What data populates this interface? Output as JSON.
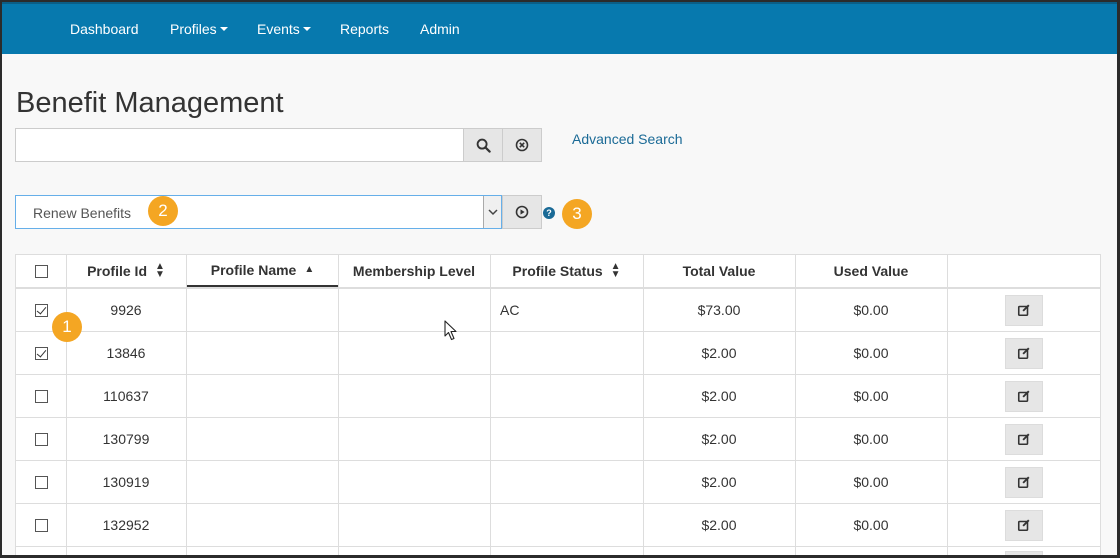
{
  "nav": {
    "items": [
      {
        "label": "Dashboard",
        "dropdown": false
      },
      {
        "label": "Profiles",
        "dropdown": true
      },
      {
        "label": "Events",
        "dropdown": true
      },
      {
        "label": "Reports",
        "dropdown": false
      },
      {
        "label": "Admin",
        "dropdown": false
      }
    ]
  },
  "page": {
    "title": "Benefit Management"
  },
  "search": {
    "value": "",
    "placeholder": "",
    "advanced_label": "Advanced Search"
  },
  "action": {
    "selected": "Renew Benefits"
  },
  "badges": [
    "1",
    "2",
    "3"
  ],
  "table": {
    "columns": [
      {
        "label": "",
        "sort": "none"
      },
      {
        "label": "Profile Id",
        "sort": "both"
      },
      {
        "label": "Profile Name",
        "sort": "asc"
      },
      {
        "label": "Membership Level",
        "sort": "none"
      },
      {
        "label": "Profile Status",
        "sort": "both"
      },
      {
        "label": "Total Value",
        "sort": "none"
      },
      {
        "label": "Used Value",
        "sort": "none"
      },
      {
        "label": "",
        "sort": "none"
      }
    ],
    "rows": [
      {
        "checked": true,
        "profile_id": "9926",
        "profile_name": "",
        "membership_level": "",
        "profile_status": "AC",
        "total_value": "$73.00",
        "used_value": "$0.00"
      },
      {
        "checked": true,
        "profile_id": "13846",
        "profile_name": "",
        "membership_level": "",
        "profile_status": "",
        "total_value": "$2.00",
        "used_value": "$0.00"
      },
      {
        "checked": false,
        "profile_id": "110637",
        "profile_name": "",
        "membership_level": "",
        "profile_status": "",
        "total_value": "$2.00",
        "used_value": "$0.00"
      },
      {
        "checked": false,
        "profile_id": "130799",
        "profile_name": "",
        "membership_level": "",
        "profile_status": "",
        "total_value": "$2.00",
        "used_value": "$0.00"
      },
      {
        "checked": false,
        "profile_id": "130919",
        "profile_name": "",
        "membership_level": "",
        "profile_status": "",
        "total_value": "$2.00",
        "used_value": "$0.00"
      },
      {
        "checked": false,
        "profile_id": "132952",
        "profile_name": "",
        "membership_level": "",
        "profile_status": "",
        "total_value": "$2.00",
        "used_value": "$0.00"
      }
    ]
  },
  "colors": {
    "navbar": "#0779ae",
    "badge": "#f4a623",
    "link": "#1a6a96"
  },
  "icons": [
    "search-icon",
    "clear-icon",
    "chevron-down-icon",
    "play-icon",
    "help-icon",
    "edit-icon",
    "sort-icon",
    "mouse-cursor-icon"
  ]
}
